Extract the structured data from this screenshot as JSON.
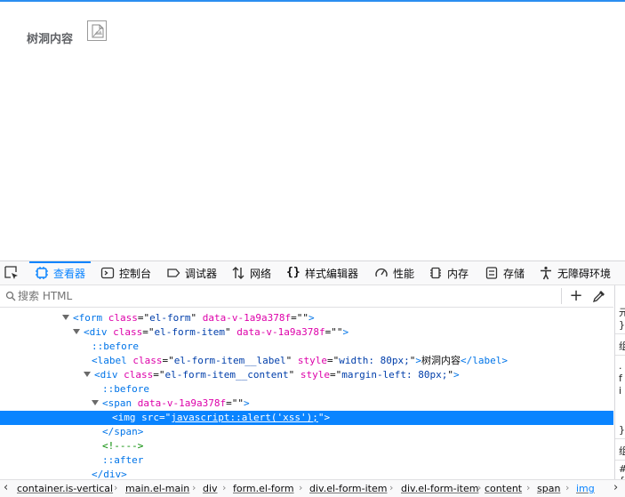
{
  "page": {
    "form_label": "树洞内容"
  },
  "devtools": {
    "tabs": [
      {
        "label": "查看器",
        "icon": "inspector-icon",
        "active": true
      },
      {
        "label": "控制台",
        "icon": "console-icon"
      },
      {
        "label": "调试器",
        "icon": "debugger-icon"
      },
      {
        "label": "网络",
        "icon": "network-icon"
      },
      {
        "label": "样式编辑器",
        "icon": "style-editor-icon"
      },
      {
        "label": "性能",
        "icon": "performance-icon"
      },
      {
        "label": "内存",
        "icon": "memory-icon"
      },
      {
        "label": "存储",
        "icon": "storage-icon"
      },
      {
        "label": "无障碍环境",
        "icon": "accessibility-icon"
      }
    ],
    "search": {
      "placeholder": "搜索 HTML",
      "value": ""
    },
    "tree": {
      "r1": {
        "tag": "form",
        "a1": "class",
        "v1": "el-form",
        "a2": "data-v-1a9a378f",
        "v2": ""
      },
      "r2": {
        "tag": "div",
        "a1": "class",
        "v1": "el-form-item",
        "a2": "data-v-1a9a378f",
        "v2": ""
      },
      "r3": {
        "pseudo": "::before"
      },
      "r4": {
        "tag": "label",
        "a1": "class",
        "v1": "el-form-item__label",
        "a2": "style",
        "v2": "width: 80px;",
        "text": "树洞内容",
        "close": "label"
      },
      "r5": {
        "tag": "div",
        "a1": "class",
        "v1": "el-form-item__content",
        "a2": "style",
        "v2": "margin-left: 80px;"
      },
      "r6": {
        "pseudo": "::before"
      },
      "r7": {
        "tag": "span",
        "a1": "data-v-1a9a378f",
        "v1": ""
      },
      "r8": {
        "tag": "img",
        "a1": "src",
        "v1": "javascript::alert('xss');"
      },
      "r9": {
        "close": "span"
      },
      "r10": {
        "comment": "<!---->"
      },
      "r11": {
        "pseudo": "::after"
      },
      "r12": {
        "close": "div"
      }
    },
    "side": [
      "元",
      "}",
      "组",
      ".",
      "f",
      "i",
      "}",
      "组",
      "#",
      "{"
    ],
    "breadcrumbs": [
      "container.is-vertical",
      "main.el-main",
      "div",
      "form.el-form",
      "div.el-form-item",
      "div.el-form-item",
      "content",
      "span",
      "img"
    ]
  },
  "colors": {
    "accent": "#0a84ff",
    "tag": "#0074e8",
    "attr": "#dd00a9",
    "value": "#003eaa",
    "comment": "#058b00"
  }
}
